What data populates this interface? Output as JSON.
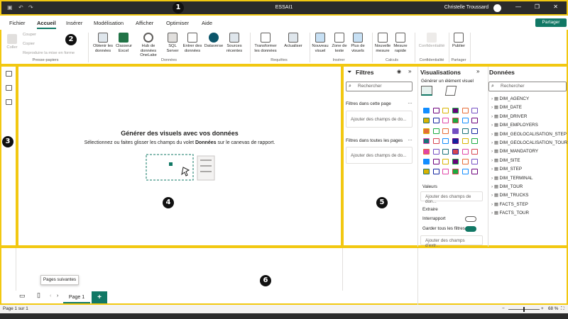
{
  "title_bar": {
    "file_title": "ESSAI1",
    "user_name": "Christelle Troussard",
    "badge": "1"
  },
  "ribbon_tabs": [
    "Fichier",
    "Accueil",
    "Insérer",
    "Modélisation",
    "Afficher",
    "Optimiser",
    "Aide"
  ],
  "share_label": "Partager",
  "clipboard": {
    "paste": "Coller",
    "cut": "Couper",
    "copy": "Copier",
    "format_painter": "Reproduire la mise en forme",
    "group": "Presse-papiers"
  },
  "data_group": {
    "get_data": "Obtenir les données",
    "excel": "Classeur Excel",
    "onelake": "Hub de données OneLake",
    "sql": "SQL Server",
    "enter_data": "Entrer des données",
    "dataverse": "Dataverse",
    "recent_sources": "Sources récentes",
    "group": "Données"
  },
  "queries_group": {
    "transform": "Transformer les données",
    "refresh": "Actualiser",
    "group": "Requêtes"
  },
  "insert_group": {
    "new_visual": "Nouveau visuel",
    "text_box": "Zone de texte",
    "more_visuals": "Plus de visuels",
    "group": "Insérer"
  },
  "calc_group": {
    "new_measure": "Nouvelle mesure",
    "quick_measure": "Mesure rapide",
    "group": "Calculs"
  },
  "confidentiality": {
    "label": "Confidentialité",
    "group": "Confidentialité"
  },
  "share_group": {
    "publish": "Publier",
    "group": "Partager"
  },
  "badges": {
    "b2": "2",
    "b3": "3",
    "b4": "4",
    "b5": "5",
    "b6": "6"
  },
  "canvas": {
    "heading": "Générer des visuels avec vos données",
    "sub_before": "Sélectionnez ou faites glisser les champs du volet ",
    "sub_bold": "Données",
    "sub_after": " sur le canevas de rapport."
  },
  "filters": {
    "title": "Filtres",
    "search_placeholder": "Rechercher",
    "on_page": "Filtres dans cette page",
    "all_pages": "Filtres dans toutes les pages",
    "add_fields": "Ajouter des champs de do..."
  },
  "visualisations": {
    "title": "Visualisations",
    "build_visual": "Générer un élément visuel",
    "values": "Valeurs",
    "add_values": "Ajouter des champs de don...",
    "drillthrough": "Extraire",
    "cross_report": "Interrapport",
    "keep_filters": "Garder tous les filtres",
    "add_drill": "Ajouter des champs d'extr..."
  },
  "data_pane": {
    "title": "Données",
    "search_placeholder": "Rechercher",
    "fields": [
      "DIM_AGENCY",
      "DIM_DATE",
      "DIM_DRIVER",
      "DIM_EMPLOYERS",
      "DIM_GEOLOCALISATION_STEP",
      "DIM_GEOLOCALISATION_TOUR",
      "DIM_MANDATORY",
      "DIM_SITE",
      "DIM_STEP",
      "DIM_TERMINAL",
      "DIM_TOUR",
      "DIM_TRUCKS",
      "FACTS_STEP",
      "FACTS_TOUR"
    ]
  },
  "pages": {
    "tooltip": "Pages suivantes",
    "page1": "Page 1"
  },
  "status": {
    "page_info": "Page 1 sur 1",
    "zoom": "68 %"
  },
  "colors": {
    "accent": "#117865",
    "highlight": "#f2c811",
    "titlebar": "#2b2b2b"
  }
}
